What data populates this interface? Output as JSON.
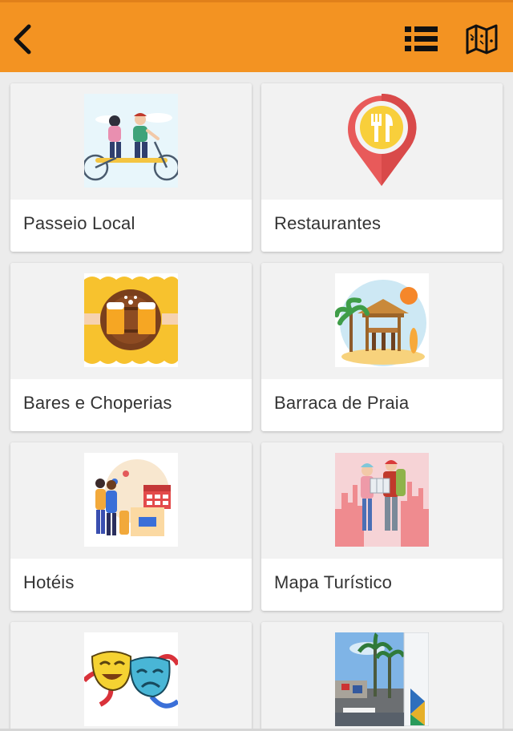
{
  "header": {
    "back_icon": "chevron-left-icon",
    "list_icon": "list-icon",
    "map_icon": "map-icon",
    "color": "#f39322"
  },
  "categories": [
    {
      "label": "Passeio Local",
      "icon": "tandem-bicycle-illustration"
    },
    {
      "label": "Restaurantes",
      "icon": "restaurant-pin-illustration"
    },
    {
      "label": "Bares e Choperias",
      "icon": "beer-toast-illustration"
    },
    {
      "label": "Barraca de Praia",
      "icon": "beach-hut-illustration"
    },
    {
      "label": "Hotéis",
      "icon": "hotel-travelers-illustration"
    },
    {
      "label": "Mapa Turístico",
      "icon": "tourists-map-illustration"
    },
    {
      "label": "",
      "icon": "theater-masks-illustration"
    },
    {
      "label": "",
      "icon": "street-sign-photo"
    }
  ]
}
